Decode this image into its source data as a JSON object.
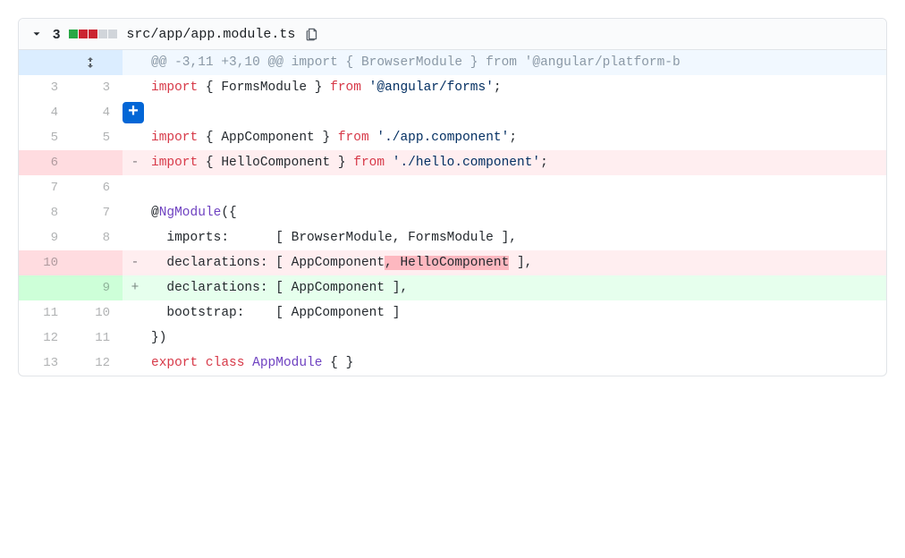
{
  "header": {
    "change_count": "3",
    "diffstat": [
      "add",
      "del",
      "del",
      "neutral",
      "neutral"
    ],
    "filepath": "src/app/app.module.ts"
  },
  "hunk": "@@ -3,11 +3,10 @@ import { BrowserModule } from '@angular/platform-b",
  "rows": [
    {
      "old": "3",
      "new": "3",
      "type": "context",
      "marker": "",
      "tokens": [
        [
          "kw",
          "import"
        ],
        [
          "",
          " { FormsModule } "
        ],
        [
          "kw",
          "from"
        ],
        [
          "",
          " "
        ],
        [
          "str",
          "'@angular/forms'"
        ],
        [
          "",
          ";"
        ]
      ]
    },
    {
      "old": "4",
      "new": "4",
      "type": "context",
      "marker": "",
      "tokens": [],
      "add_button": true
    },
    {
      "old": "5",
      "new": "5",
      "type": "context",
      "marker": "",
      "tokens": [
        [
          "kw",
          "import"
        ],
        [
          "",
          " { AppComponent } "
        ],
        [
          "kw",
          "from"
        ],
        [
          "",
          " "
        ],
        [
          "str",
          "'./app.component'"
        ],
        [
          "",
          ";"
        ]
      ]
    },
    {
      "old": "6",
      "new": "",
      "type": "del",
      "marker": "-",
      "tokens": [
        [
          "kw",
          "import"
        ],
        [
          "",
          " { HelloComponent } "
        ],
        [
          "kw",
          "from"
        ],
        [
          "",
          " "
        ],
        [
          "str",
          "'./hello.component'"
        ],
        [
          "",
          ";"
        ]
      ]
    },
    {
      "old": "7",
      "new": "6",
      "type": "context",
      "marker": "",
      "tokens": []
    },
    {
      "old": "8",
      "new": "7",
      "type": "context",
      "marker": "",
      "tokens": [
        [
          "",
          "@"
        ],
        [
          "dec",
          "NgModule"
        ],
        [
          "",
          "({"
        ]
      ]
    },
    {
      "old": "9",
      "new": "8",
      "type": "context",
      "marker": "",
      "tokens": [
        [
          "",
          "  imports:      [ BrowserModule, FormsModule ],"
        ]
      ]
    },
    {
      "old": "10",
      "new": "",
      "type": "del",
      "marker": "-",
      "tokens": [
        [
          "",
          "  declarations: [ AppComponent"
        ],
        [
          "idel",
          ", HelloComponent"
        ],
        [
          "",
          " ],"
        ]
      ]
    },
    {
      "old": "",
      "new": "9",
      "type": "add",
      "marker": "+",
      "tokens": [
        [
          "",
          "  declarations: [ AppComponent ],"
        ]
      ]
    },
    {
      "old": "11",
      "new": "10",
      "type": "context",
      "marker": "",
      "tokens": [
        [
          "",
          "  bootstrap:    [ AppComponent ]"
        ]
      ]
    },
    {
      "old": "12",
      "new": "11",
      "type": "context",
      "marker": "",
      "tokens": [
        [
          "",
          "})"
        ]
      ]
    },
    {
      "old": "13",
      "new": "12",
      "type": "context",
      "marker": "",
      "tokens": [
        [
          "kw",
          "export"
        ],
        [
          "",
          " "
        ],
        [
          "kw",
          "class"
        ],
        [
          "",
          " "
        ],
        [
          "cls",
          "AppModule"
        ],
        [
          "",
          " { }"
        ]
      ]
    }
  ]
}
